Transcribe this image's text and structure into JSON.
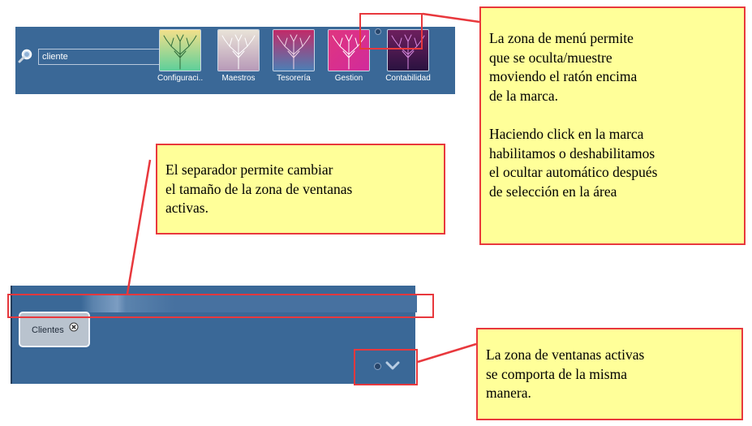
{
  "menu": {
    "search": {
      "value": "cliente"
    },
    "tiles": [
      {
        "label": "Configuraci...",
        "icon": "tree-icon",
        "colors": [
          "#5ecf9a",
          "#f2e08a"
        ]
      },
      {
        "label": "Maestros",
        "icon": "tree-icon",
        "colors": [
          "#b89ab8",
          "#e9e3d8"
        ]
      },
      {
        "label": "Tesorería",
        "icon": "tree-icon",
        "colors": [
          "#c22a68",
          "#4c7fb5"
        ]
      },
      {
        "label": "Gestion",
        "icon": "tree-icon",
        "colors": [
          "#e0357f",
          "#d12b9b"
        ]
      },
      {
        "label": "Contabilidad",
        "icon": "tree-icon",
        "colors": [
          "#6e1f5e",
          "#2a1240"
        ]
      }
    ]
  },
  "window_zone": {
    "tabs": [
      {
        "label": "Clientes"
      }
    ]
  },
  "callouts": {
    "menu_zone": {
      "lines": [
        "La zona de menú permite",
        "que se oculta/muestre",
        "moviendo el ratón encima",
        "de la marca.",
        "",
        "Haciendo click en la marca",
        "habilitamos o deshabilitamos",
        "el ocultar automático después",
        "de selección en la área"
      ]
    },
    "separator": {
      "lines": [
        "El separador permite cambiar",
        "el tamaño de la zona de ventanas",
        "activas."
      ]
    },
    "window_zone": {
      "lines": [
        "La zona de ventanas activas",
        "se comporta de la misma",
        "manera."
      ]
    }
  },
  "colors": {
    "panel": "#3a6897",
    "callout_fill": "#ffff99",
    "highlight": "#e8383d"
  }
}
